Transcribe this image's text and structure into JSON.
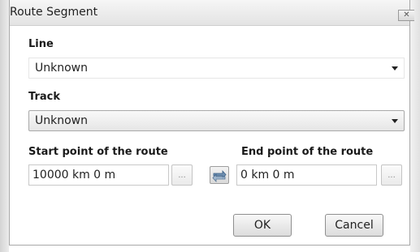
{
  "window": {
    "title": "Route Segment",
    "close_icon": "close-icon"
  },
  "line": {
    "label": "Line",
    "value": "Unknown"
  },
  "track": {
    "label": "Track",
    "value": "Unknown"
  },
  "start": {
    "label": "Start point of the route",
    "value": "10000 km 0 m",
    "browse_label": "..."
  },
  "end": {
    "label": "End point of the route",
    "value": "0 km 0 m",
    "browse_label": "..."
  },
  "swap_icon": "swap-arrows-icon",
  "buttons": {
    "ok": "OK",
    "cancel": "Cancel"
  }
}
